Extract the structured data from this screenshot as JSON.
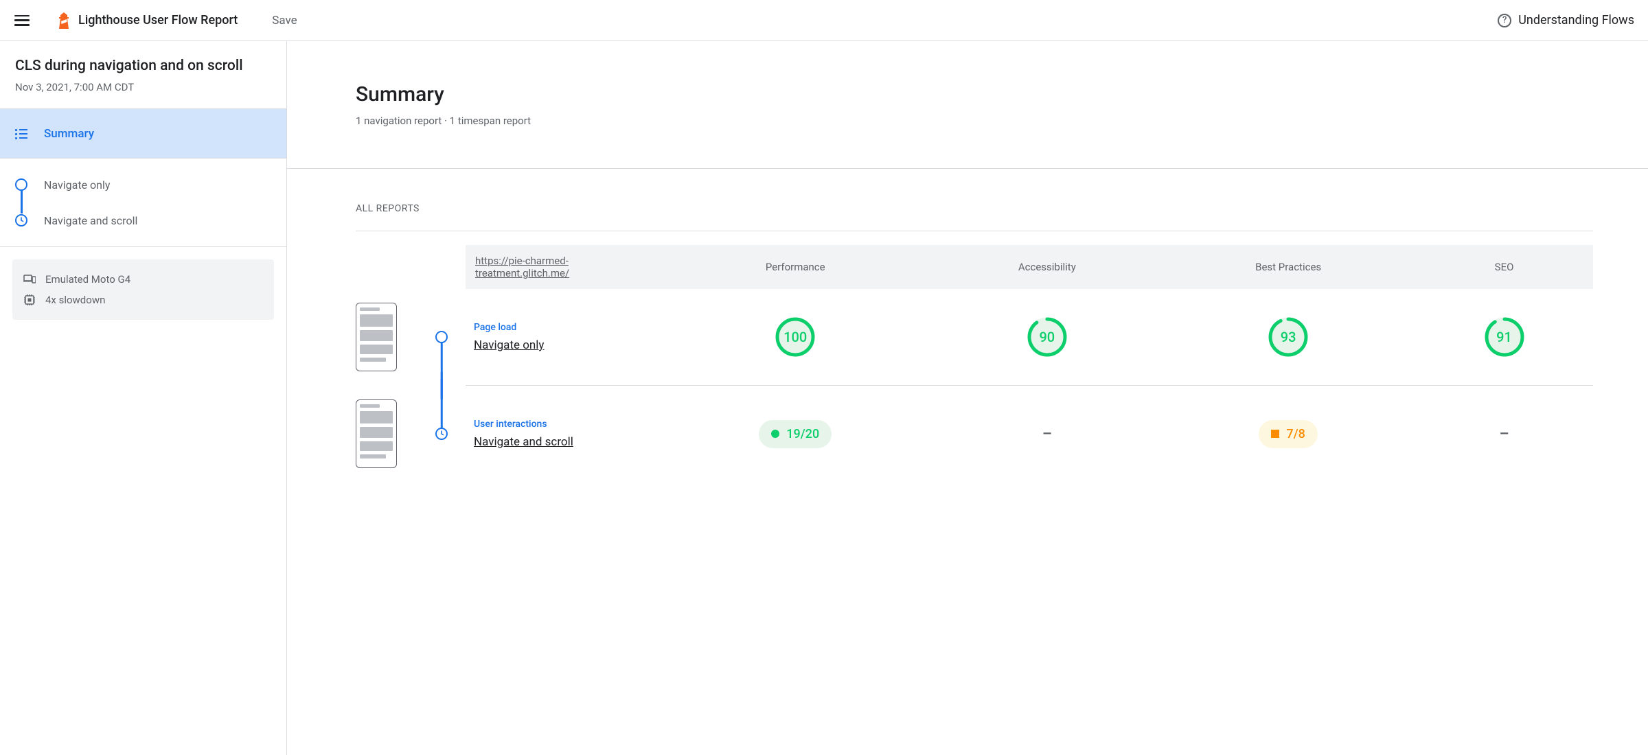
{
  "topbar": {
    "app_title": "Lighthouse User Flow Report",
    "save_label": "Save",
    "help_label": "Understanding Flows"
  },
  "sidebar": {
    "flow_title": "CLS during navigation and on scroll",
    "flow_date": "Nov 3, 2021, 7:00 AM CDT",
    "summary_label": "Summary",
    "steps": [
      {
        "label": "Navigate only",
        "type": "navigation"
      },
      {
        "label": "Navigate and scroll",
        "type": "timespan"
      }
    ],
    "env": {
      "device": "Emulated Moto G4",
      "cpu": "4x slowdown"
    }
  },
  "main": {
    "title": "Summary",
    "subtitle": "1 navigation report · 1 timespan report",
    "all_reports_label": "ALL REPORTS",
    "url": "https://pie-charmed-treatment.glitch.me/",
    "columns": {
      "performance": "Performance",
      "accessibility": "Accessibility",
      "best_practices": "Best Practices",
      "seo": "SEO"
    },
    "rows": [
      {
        "step_type_label": "Page load",
        "step_name": "Navigate only",
        "marker": "navigation",
        "scores": {
          "performance": {
            "kind": "gauge",
            "value": 100
          },
          "accessibility": {
            "kind": "gauge",
            "value": 90
          },
          "best_practices": {
            "kind": "gauge",
            "value": 93
          },
          "seo": {
            "kind": "gauge",
            "value": 91
          }
        }
      },
      {
        "step_type_label": "User interactions",
        "step_name": "Navigate and scroll",
        "marker": "timespan",
        "scores": {
          "performance": {
            "kind": "pill-green",
            "text": "19/20"
          },
          "accessibility": {
            "kind": "dash"
          },
          "best_practices": {
            "kind": "pill-orange",
            "text": "7/8"
          },
          "seo": {
            "kind": "dash"
          }
        }
      }
    ]
  }
}
